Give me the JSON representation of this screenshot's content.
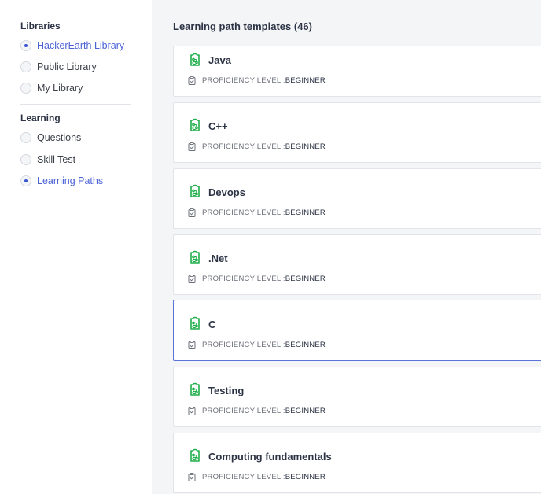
{
  "sidebar": {
    "libraries_heading": "Libraries",
    "libraries": [
      {
        "label": "HackerEarth Library",
        "selected": true
      },
      {
        "label": "Public Library",
        "selected": false
      },
      {
        "label": "My Library",
        "selected": false
      }
    ],
    "learning_heading": "Learning",
    "learning": [
      {
        "label": "Questions",
        "selected": false
      },
      {
        "label": "Skill Test",
        "selected": false
      },
      {
        "label": "Learning Paths",
        "selected": true
      }
    ]
  },
  "main": {
    "title": "Learning path templates (46)",
    "proficiency_label": "PROFICIENCY LEVEL :",
    "cards": [
      {
        "title": "Java",
        "level": "BEGINNER"
      },
      {
        "title": "C++",
        "level": "BEGINNER"
      },
      {
        "title": "Devops",
        "level": "BEGINNER"
      },
      {
        "title": ".Net",
        "level": "BEGINNER"
      },
      {
        "title": "C",
        "level": "BEGINNER"
      },
      {
        "title": "Testing",
        "level": "BEGINNER"
      },
      {
        "title": "Computing fundamentals",
        "level": "BEGINNER"
      }
    ]
  },
  "colors": {
    "accent": "#4a62d6",
    "icon_green": "#1fae4a",
    "active_border": "#5b73d8"
  },
  "icons": {
    "card": "learning-path-icon",
    "meta": "clipboard-check-icon"
  }
}
